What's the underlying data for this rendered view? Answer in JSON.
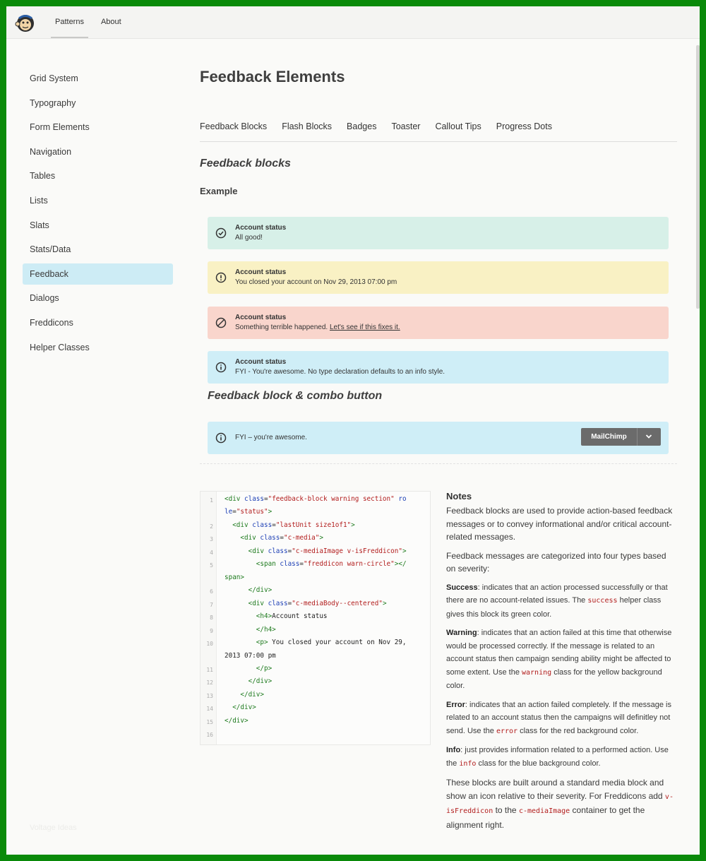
{
  "topnav": {
    "items": [
      "Patterns",
      "About"
    ]
  },
  "sidebar": {
    "items": [
      "Grid System",
      "Typography",
      "Form Elements",
      "Navigation",
      "Tables",
      "Lists",
      "Slats",
      "Stats/Data",
      "Feedback",
      "Dialogs",
      "Freddicons",
      "Helper Classes"
    ],
    "active": "Feedback"
  },
  "footer_text": "Voltage Ideas",
  "page": {
    "title": "Feedback Elements",
    "tabs": [
      "Feedback Blocks",
      "Flash Blocks",
      "Badges",
      "Toaster",
      "Callout Tips",
      "Progress Dots"
    ],
    "section_title": "Feedback blocks",
    "example_label": "Example"
  },
  "feedback_blocks": [
    {
      "type": "success",
      "icon": "check-circle-icon",
      "heading": "Account status",
      "message": "All good!",
      "link": ""
    },
    {
      "type": "warning",
      "icon": "warn-circle-icon",
      "heading": "Account status",
      "message": "You closed your account on Nov 29, 2013 07:00 pm",
      "link": ""
    },
    {
      "type": "error",
      "icon": "not-allowed-icon",
      "heading": "Account status",
      "message": "Something terrible happened. ",
      "link": "Let's see if this fixes it."
    },
    {
      "type": "info",
      "icon": "info-circle-icon",
      "heading": "Account status",
      "message": "FYI - You're awesome. No type declaration defaults to an info style.",
      "link": ""
    }
  ],
  "combo": {
    "title": "Feedback block & combo button",
    "message": "FYI – you're awesome.",
    "button_label": "MailChimp"
  },
  "code_lines": [
    "1",
    "",
    "2",
    "3",
    "4",
    "5",
    "",
    "6",
    "7",
    "8",
    "9",
    "10",
    "",
    "11",
    "12",
    "13",
    "14",
    "15",
    "16"
  ],
  "notes": {
    "title": "Notes",
    "p1": "Feedback blocks are used to provide action-based feedback messages or to convey informational and/or critical account-related messages.",
    "p2": "Feedback messages are categorized into four types based on severity:",
    "success_label": "Success",
    "success_text_a": ": indicates that an action processed successfully or that there are no account-related issues. The ",
    "success_code": "success",
    "success_text_b": " helper class gives this block its green color.",
    "warning_label": "Warning",
    "warning_text_a": ": indicates that an action failed at this time that otherwise would be processed correctly. If the message is related to an account status then campaign sending ability might be affected to some extent. Use the ",
    "warning_code": "warning",
    "warning_text_b": " class for the yellow background color.",
    "error_label": "Error",
    "error_text_a": ": indicates that an action failed completely. If the message is related to an account status then the campaigns will definitley not send. Use the ",
    "error_code": "error",
    "error_text_b": " class for the red background color.",
    "info_label": "Info",
    "info_text_a": ": just provides information related to a performed action. Use the ",
    "info_code": "info",
    "info_text_b": " class for the blue background color.",
    "p_last_a": "These blocks are built around a standard media block and show an icon relative to their severity. For Freddicons add ",
    "p_last_code1": "v-isFreddicon",
    "p_last_b": " to the ",
    "p_last_code2": "c-mediaImage",
    "p_last_c": " container to get the alignment right."
  },
  "colors": {
    "success": "#d7f0e8",
    "warning": "#f9f1c4",
    "error": "#f9d5cc",
    "info": "#cfeef7",
    "active_nav": "#cdecf5",
    "frame": "#0a8a0a"
  }
}
